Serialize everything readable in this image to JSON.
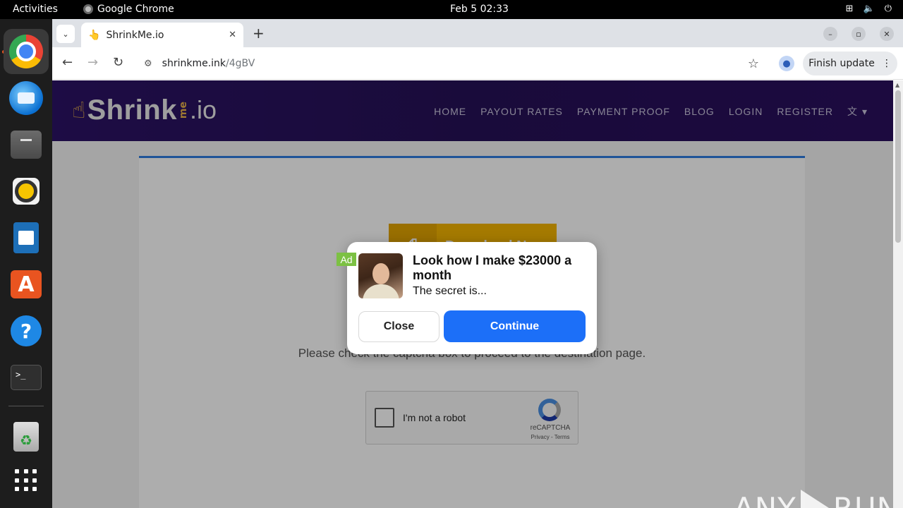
{
  "topbar": {
    "activities": "Activities",
    "app_name": "Google Chrome",
    "clock": "Feb 5  02:33",
    "tray_icons": [
      "network-icon",
      "volume-icon",
      "power-icon"
    ]
  },
  "dock": {
    "items": [
      "chrome",
      "thunderbird",
      "files",
      "rhythmbox",
      "libreoffice-writer",
      "app-center",
      "help",
      "terminal",
      "trash",
      "show-apps"
    ],
    "terminal_prompt": ">_"
  },
  "browser": {
    "tab_title": "ShrinkMe.io",
    "tab_favicon": "👆",
    "url_host": "shrinkme.ink",
    "url_path": "/4gBV",
    "finish_update": "Finish update"
  },
  "site": {
    "logo": {
      "word": "Shrink",
      "me": "me",
      "io": ".io"
    },
    "nav": [
      "HOME",
      "PAYOUT RATES",
      "PAYMENT PROOF",
      "BLOG",
      "LOGIN",
      "REGISTER"
    ],
    "download_label": "Download Now",
    "instructions": "Please check the captcha box to proceed to the destination page.",
    "recaptcha": {
      "label": "I'm not a robot",
      "brand": "reCAPTCHA",
      "terms": "Privacy - Terms"
    }
  },
  "ad": {
    "badge": "Ad",
    "title": "Look how I make $23000 a month",
    "subtitle": "The secret is...",
    "close_label": "Close",
    "continue_label": "Continue"
  },
  "watermark": {
    "left": "ANY",
    "right": "RUN"
  },
  "colors": {
    "header_bg": "#261157",
    "accent_blue": "#1c6ff8",
    "ad_green": "#7cc143",
    "download_yellow": "#f4b400",
    "card_border": "#2e7de0"
  }
}
